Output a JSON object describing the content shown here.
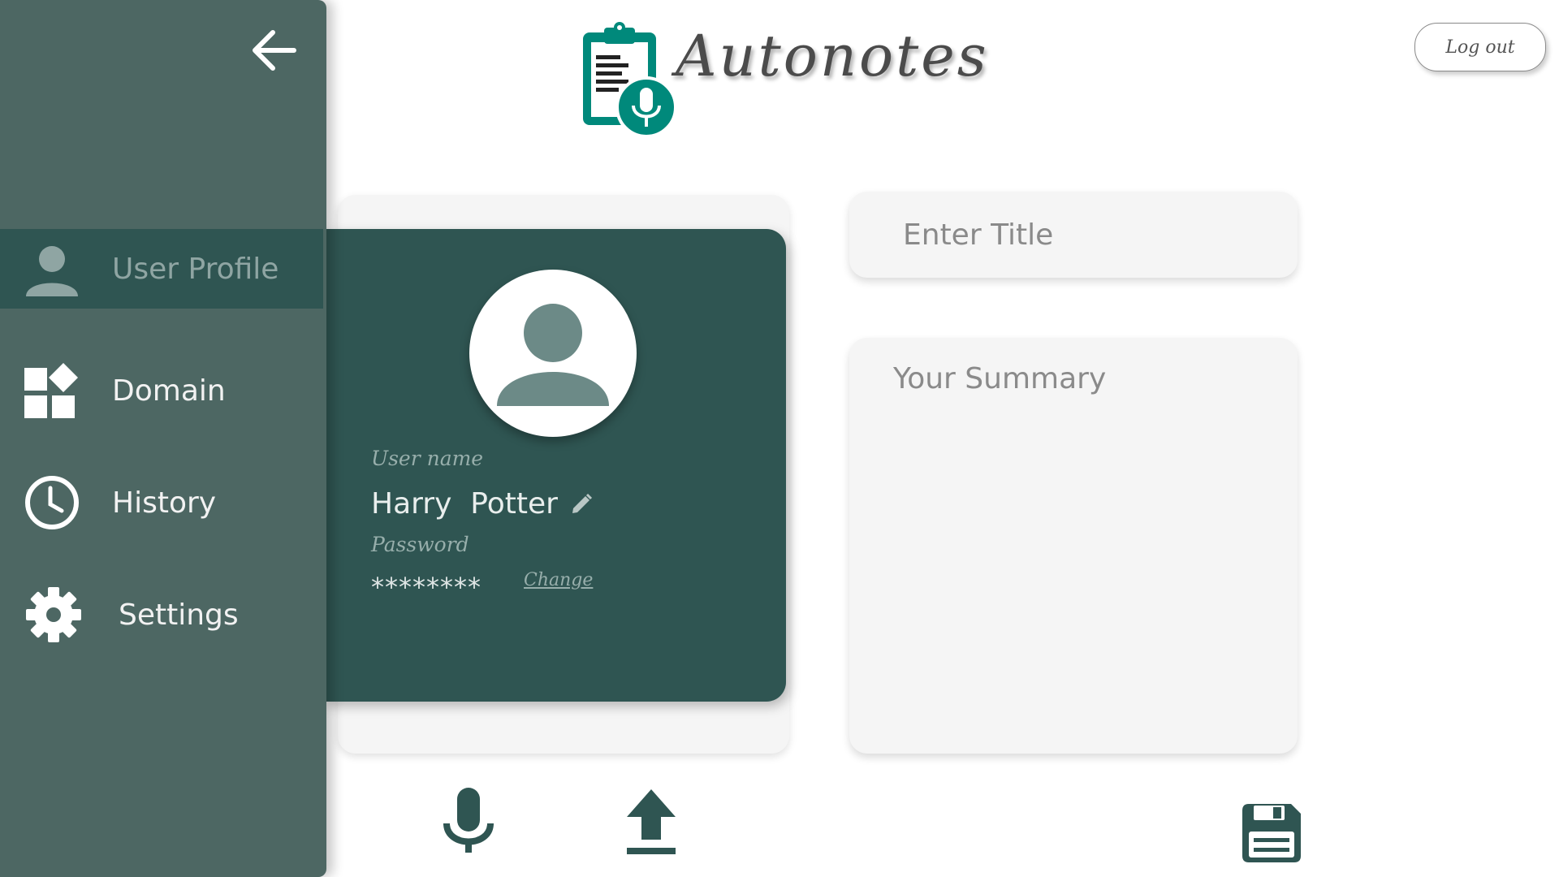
{
  "app": {
    "title": "Autonotes",
    "logout_label": "Log out"
  },
  "sidebar": {
    "items": [
      {
        "label": "User Profile",
        "icon": "user-icon",
        "active": true
      },
      {
        "label": "Domain",
        "icon": "domain-icon"
      },
      {
        "label": "History",
        "icon": "clock-icon"
      },
      {
        "label": "Settings",
        "icon": "gear-icon"
      }
    ]
  },
  "profile": {
    "username_label": "User name",
    "username": "Harry  Potter",
    "password_label": "Password",
    "password_mask": "********",
    "change_label": "Change"
  },
  "editor": {
    "title_placeholder": "Enter Title",
    "summary_placeholder": "Your Summary"
  },
  "actions": {
    "icons": [
      "microphone-icon",
      "upload-icon",
      "save-icon"
    ]
  },
  "colors": {
    "sidebar": "#4d6763",
    "panel": "#2f5552",
    "brand": "#00897b",
    "card": "#f5f5f5"
  }
}
